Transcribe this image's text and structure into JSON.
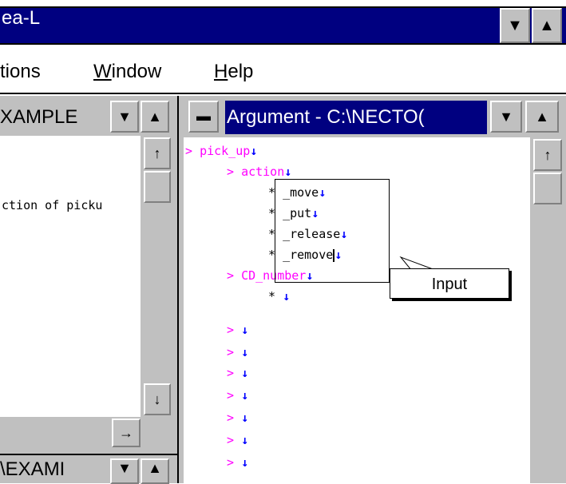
{
  "app": {
    "title": "ea-L"
  },
  "menu": [
    {
      "label_pre": "",
      "label_u": "",
      "label_post": "tions"
    },
    {
      "label_pre": "",
      "label_u": "W",
      "label_post": "indow"
    },
    {
      "label_pre": "",
      "label_u": "H",
      "label_post": "elp"
    }
  ],
  "left_window": {
    "title": "XAMPLE",
    "content": "ction of picku"
  },
  "bottom_left_window": {
    "title": "\\EXAMI"
  },
  "argument_window": {
    "title": "Argument - C:\\NECTO(",
    "lines": [
      {
        "prefix": "> ",
        "text": "pick_up"
      },
      {
        "prefix": "> ",
        "text": "action"
      },
      {
        "prefix": "* ",
        "text": "_move"
      },
      {
        "prefix": "* ",
        "text": "_put"
      },
      {
        "prefix": "* ",
        "text": "_release"
      },
      {
        "prefix": "* ",
        "text": "_remove"
      },
      {
        "prefix": "> ",
        "text": "CD_number"
      },
      {
        "prefix": "* ",
        "text": ""
      },
      {
        "prefix": "> ",
        "text": ""
      },
      {
        "prefix": "> ",
        "text": ""
      },
      {
        "prefix": "> ",
        "text": ""
      },
      {
        "prefix": "> ",
        "text": ""
      },
      {
        "prefix": "> ",
        "text": ""
      },
      {
        "prefix": "> ",
        "text": ""
      },
      {
        "prefix": "> ",
        "text": ""
      }
    ]
  },
  "callout": {
    "label": "Input"
  },
  "glyphs": {
    "down": "▼",
    "up": "▲",
    "left_arrow_up": "↑",
    "arrow_down": "↓",
    "arrow_right": "→",
    "line_end": "↓",
    "minimize": "▬"
  }
}
